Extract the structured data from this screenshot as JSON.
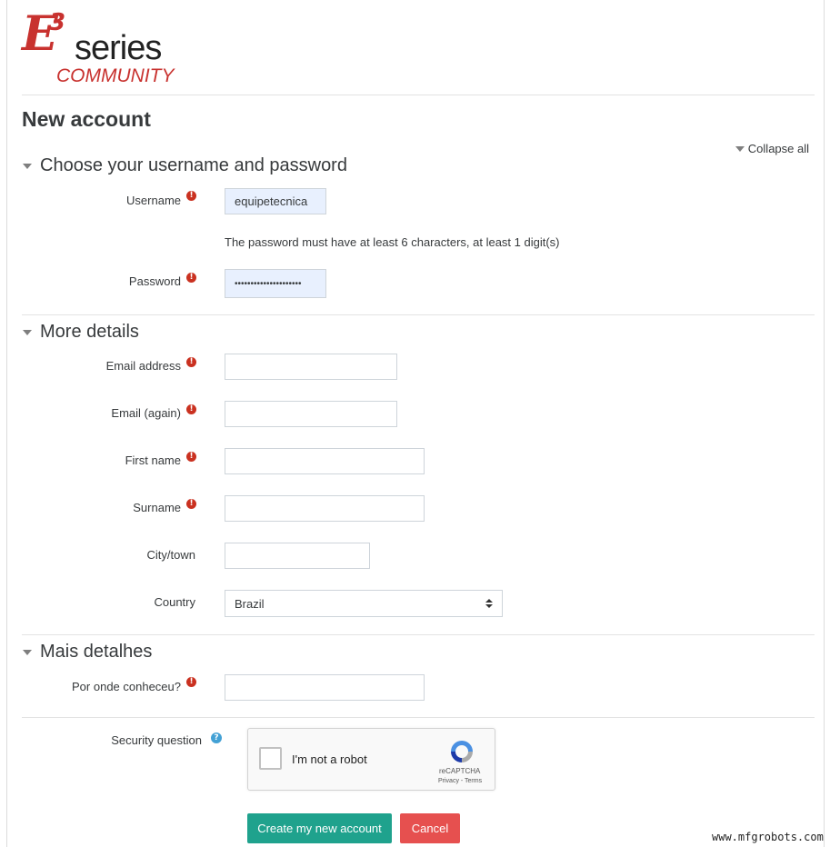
{
  "logo": {
    "e": "E",
    "three": "3",
    "series": "series",
    "community": "COMMUNITY"
  },
  "page": {
    "title": "New account",
    "collapse_all": "Collapse all"
  },
  "sections": {
    "credentials": {
      "title": "Choose your username and password",
      "username": {
        "label": "Username",
        "value": "equipetecnica"
      },
      "password_note": "The password must have at least 6 characters, at least 1 digit(s)",
      "password": {
        "label": "Password",
        "value": "•••••••••••••••••••••"
      }
    },
    "more_details": {
      "title": "More details",
      "email": {
        "label": "Email address",
        "value": ""
      },
      "email_again": {
        "label": "Email (again)",
        "value": ""
      },
      "first_name": {
        "label": "First name",
        "value": ""
      },
      "surname": {
        "label": "Surname",
        "value": ""
      },
      "city": {
        "label": "City/town",
        "value": ""
      },
      "country": {
        "label": "Country",
        "value": "Brazil"
      }
    },
    "mais_detalhes": {
      "title": "Mais detalhes",
      "por_onde": {
        "label": "Por onde conheceu?",
        "value": ""
      }
    }
  },
  "security": {
    "label": "Security question",
    "captcha_text": "I'm not a robot",
    "captcha_brand": "reCAPTCHA",
    "captcha_links": "Privacy - Terms"
  },
  "buttons": {
    "create": "Create my new account",
    "cancel": "Cancel"
  },
  "watermark": "www.mfgrobots.com",
  "colors": {
    "brand_red": "#c8322f",
    "primary": "#1fa28d",
    "danger": "#e6504f",
    "required": "#ca3120",
    "help": "#43a1d5",
    "autofill": "#e8f0fe"
  }
}
